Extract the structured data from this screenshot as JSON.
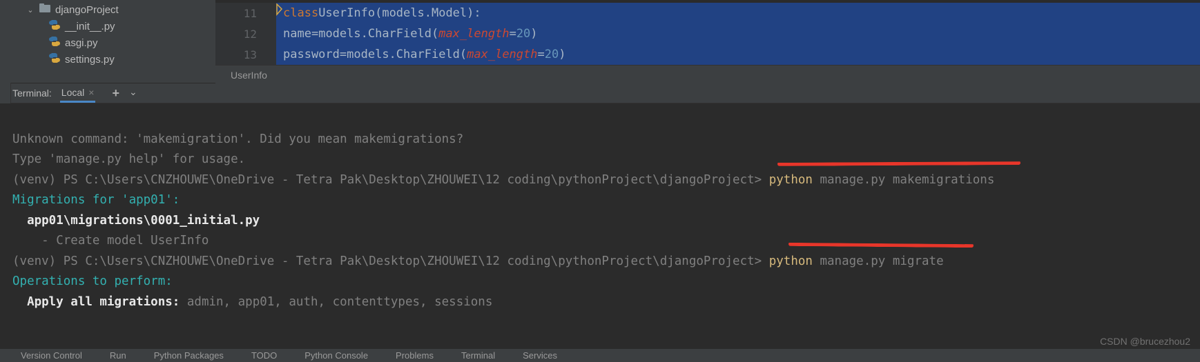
{
  "tree": {
    "folder": "djangoProject",
    "files": [
      "__init__.py",
      "asgi.py",
      "settings.py"
    ]
  },
  "editor": {
    "lines": [
      {
        "num": "11",
        "kw": "class ",
        "name": "UserInfo",
        "paren_open": "(",
        "base": "models.Model",
        "paren_close": ")",
        "colon": ":"
      },
      {
        "num": "12",
        "indent": "    ",
        "field": "name",
        "eq": " = ",
        "call": "models.CharField(",
        "arg": "max_length",
        "eq2": "=",
        "val": "20",
        "close": ")"
      },
      {
        "num": "13",
        "indent": "    ",
        "field": "password",
        "eq": " = ",
        "call": "models.CharField(",
        "arg": "max_length",
        "eq2": "=",
        "val": "20",
        "close": ")"
      }
    ],
    "breadcrumb": "UserInfo"
  },
  "terminal": {
    "title": "Terminal:",
    "tab": "Local",
    "lines": {
      "err1": "Unknown command: 'makemigration'. Did you mean makemigrations?",
      "err2": "Type 'manage.py help' for usage.",
      "prompt1_pre": "(venv) PS C:\\Users\\CNZHOUWE\\OneDrive - Tetra Pak\\Desktop\\ZHOUWEI\\12 coding\\pythonProject\\djangoProject> ",
      "cmd1_py": "python",
      "cmd1_rest": " manage.py makemigrations",
      "mig_header": "Migrations for 'app01':",
      "mig_file": "  app01\\migrations\\0001_initial.py",
      "mig_action": "    - Create model UserInfo",
      "prompt2_pre": "(venv) PS C:\\Users\\CNZHOUWE\\OneDrive - Tetra Pak\\Desktop\\ZHOUWEI\\12 coding\\pythonProject\\djangoProject> ",
      "cmd2_py": "python",
      "cmd2_rest": " manage.py migrate",
      "ops_header": "Operations to perform:",
      "ops_line_b": "  Apply all migrations: ",
      "ops_line_rest": "admin, app01, auth, contenttypes, sessions"
    }
  },
  "watermark": "CSDN @brucezhou2",
  "bottom": [
    "Version Control",
    "Run",
    "Python Packages",
    "TODO",
    "Python Console",
    "Problems",
    "Terminal",
    "Services"
  ]
}
